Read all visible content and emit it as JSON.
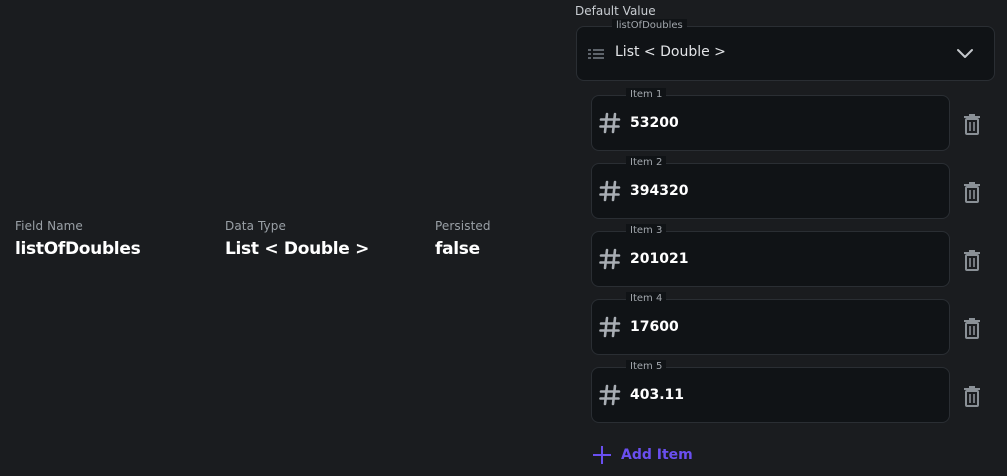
{
  "fields": [
    {
      "label": "Field Name",
      "value": "listOfDoubles"
    },
    {
      "label": "Data Type",
      "value": "List < Double >"
    },
    {
      "label": "Persisted",
      "value": "false"
    }
  ],
  "default_value": {
    "label": "Default Value",
    "type_select": {
      "label": "listOfDoubles",
      "value": "List < Double >",
      "icon": "list-icon",
      "dropdown_icon": "chevron-down-icon"
    },
    "items": [
      {
        "label": "Item 1",
        "value": "53200"
      },
      {
        "label": "Item 2",
        "value": "394320"
      },
      {
        "label": "Item 3",
        "value": "201021"
      },
      {
        "label": "Item 4",
        "value": "17600"
      },
      {
        "label": "Item 5",
        "value": "403.11"
      }
    ],
    "add_item_label": "Add Item"
  },
  "colors": {
    "background": "#1a1c1f",
    "field_background": "#101316",
    "border": "#2a2e33",
    "accent": "#6a4ff0",
    "muted_text": "#9aa0a6"
  }
}
